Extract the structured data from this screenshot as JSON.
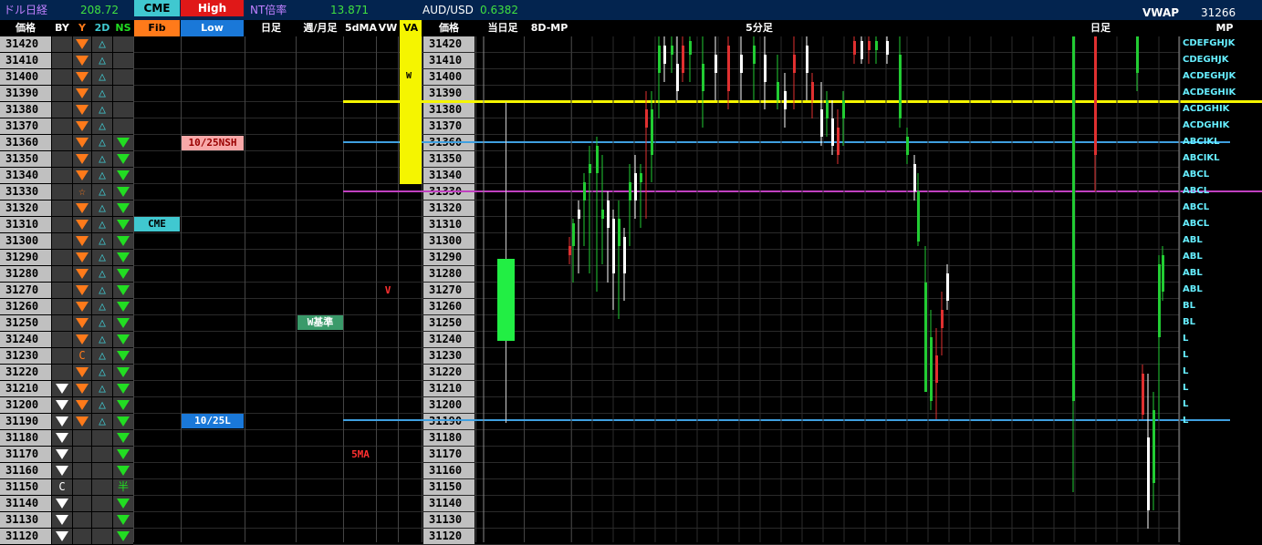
{
  "topbar": {
    "label_usd_nikkei": "ドル日経",
    "usd_nikkei_value": "208.72",
    "cme_label": "CME",
    "high_label": "High",
    "nt_ratio_label": "NT倍率",
    "nt_ratio_value": "13.871",
    "audusd_label": "AUD/USD",
    "audusd_value": "0.6382",
    "vwap_label": "VWAP",
    "vwap_value": "31266"
  },
  "header": {
    "price": "価格",
    "by": "BY",
    "y": "Y",
    "d2": "2D",
    "ns": "NS",
    "fib": "Fib",
    "low": "Low",
    "daily": "日足",
    "weekly_monthly": "週/月足",
    "ma5d": "5dMA",
    "vw": "VW",
    "va": "VA",
    "price2": "価格",
    "today": "当日足",
    "mp8d": "8D-MP",
    "min5": "5分足",
    "daily2": "日足",
    "mp": "MP"
  },
  "prices": [
    "31420",
    "31410",
    "31400",
    "31390",
    "31380",
    "31370",
    "31360",
    "31350",
    "31340",
    "31330",
    "31320",
    "31310",
    "31300",
    "31290",
    "31280",
    "31270",
    "31260",
    "31250",
    "31240",
    "31230",
    "31220",
    "31210",
    "31200",
    "31190",
    "31180",
    "31170",
    "31160",
    "31150",
    "31140",
    "31130",
    "31120"
  ],
  "tags": {
    "nsh": "10/25NSH",
    "cme": "CME",
    "w_base": "W基準",
    "low25": "10/25L",
    "ma5": "5MA",
    "v": "V",
    "w": "W",
    "y_c": "C",
    "by_c": "C",
    "ns_half": "半"
  },
  "mp_letters": [
    "CDEFGHJK",
    "CDEGHJK",
    "ACDEGHJK",
    "ACDEGHIK",
    "ACDGHIK",
    "ACDGHIK",
    "ABCIKL",
    "ABCIKL",
    "ABCL",
    "ABCL",
    "ABCL",
    "ABCL",
    "ABL",
    "ABL",
    "ABL",
    "ABL",
    "BL",
    "BL",
    "L",
    "L",
    "L",
    "L",
    "L",
    "L"
  ],
  "colors": {
    "topbar_bg": "#03244f",
    "orange": "#ff7a1a",
    "green": "#22dd22",
    "cyan": "#40c8d0",
    "yellow": "#f5f500",
    "purple": "#c040c0",
    "blue_line": "#3fa0e0"
  }
}
